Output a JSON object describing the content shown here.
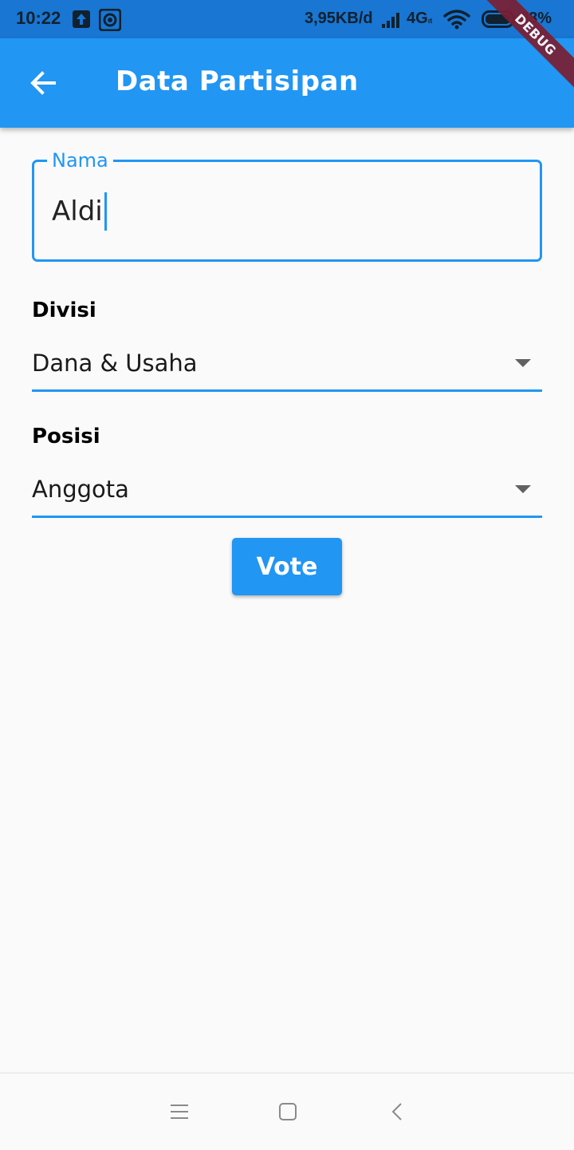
{
  "status_bar": {
    "time": "10:22",
    "net_speed": "3,95KB/d",
    "network_type": "4G",
    "network_suffix": "ıt",
    "battery": "88%",
    "icons": [
      "upload-icon",
      "sync-icon",
      "signal-icon",
      "wifi-icon",
      "battery-icon"
    ]
  },
  "debug_banner": "DEBUG",
  "app_bar": {
    "title": "Data Partisipan",
    "back_icon": "arrow-left-icon"
  },
  "form": {
    "name_field": {
      "label": "Nama",
      "value": "Aldi"
    },
    "divisi": {
      "label": "Divisi",
      "selected": "Dana & Usaha"
    },
    "posisi": {
      "label": "Posisi",
      "selected": "Anggota"
    },
    "vote_button": "Vote"
  },
  "bottom_nav": {
    "icons": [
      "menu-icon",
      "home-icon",
      "back-icon"
    ]
  },
  "colors": {
    "primary": "#2196F3",
    "status_bar": "#1976D2",
    "background": "#FAFAFA",
    "debug_banner": "#7A1F33"
  }
}
